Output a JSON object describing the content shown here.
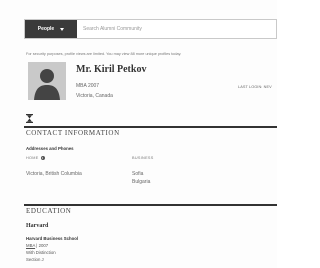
{
  "search": {
    "scope_label": "People",
    "placeholder": "Search Alumni Community"
  },
  "notice": "For security purposes, profile views are limited. You may view 88 more unique profiles today.",
  "profile": {
    "name": "Mr. Kiril Petkov",
    "degree_year": "MBA 2007",
    "location": "Victoria, Canada",
    "last_login_label": "LAST LOGIN: NEV"
  },
  "contact": {
    "title": "CONTACT INFORMATION",
    "subtitle": "Addresses and Phones",
    "home_label": "HOME",
    "business_label": "BUSINESS",
    "home_value": "Victoria, British Columbia",
    "business_line1": "Sofia",
    "business_line2": "Bulgaria"
  },
  "education": {
    "title": "EDUCATION",
    "institution": "Harvard",
    "school": "Harvard Business School",
    "degree": "MBA",
    "year": " | 2007",
    "honor": "With Distinction",
    "section": "Section J"
  }
}
